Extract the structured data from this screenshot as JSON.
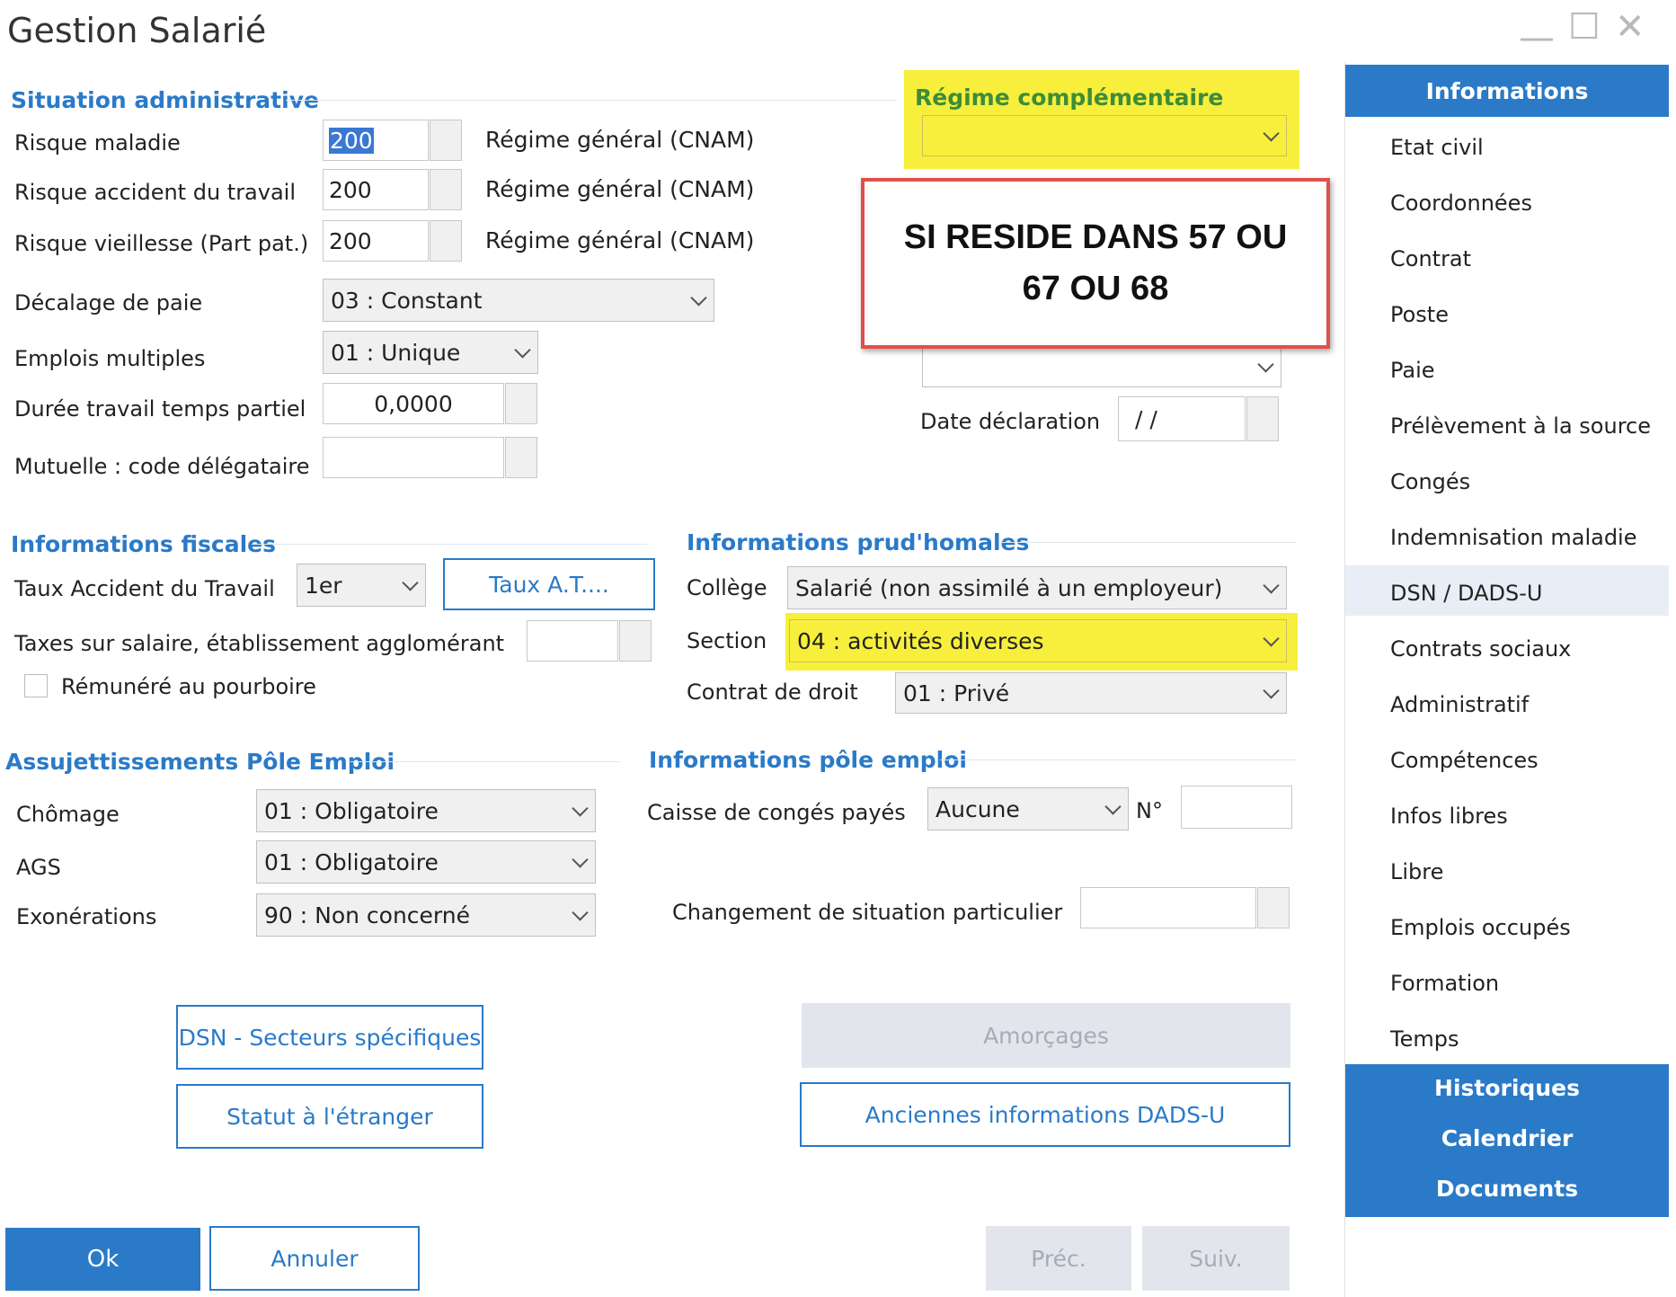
{
  "window": {
    "title": "Gestion Salarié",
    "minimize": "—",
    "maximize": "☐",
    "close": "✕"
  },
  "situation_admin": {
    "title": "Situation administrative",
    "risque_maladie": {
      "label": "Risque maladie",
      "value": "200",
      "regime": "Régime général (CNAM)"
    },
    "risque_accident": {
      "label": "Risque accident du travail",
      "value": "200",
      "regime": "Régime général (CNAM)"
    },
    "risque_vieillesse": {
      "label": "Risque vieillesse (Part pat.)",
      "value": "200",
      "regime": "Régime général (CNAM)"
    },
    "decalage_paie": {
      "label": "Décalage de paie",
      "value": "03 : Constant"
    },
    "emplois_multiples": {
      "label": "Emplois multiples",
      "value": "01 : Unique"
    },
    "duree_travail": {
      "label": "Durée travail temps partiel",
      "value": "0,0000"
    },
    "mutuelle": {
      "label": "Mutuelle : code délégataire",
      "value": ""
    }
  },
  "regime_complementaire": {
    "title": "Régime complémentaire",
    "value": ""
  },
  "annotation": {
    "line1": "SI RESIDE DANS 57 OU",
    "line2": "67 OU 68"
  },
  "date_declaration": {
    "label": "Date déclaration",
    "value": "/ /"
  },
  "infos_fiscales": {
    "title": "Informations fiscales",
    "taux_accident": {
      "label": "Taux Accident du Travail",
      "value": "1er"
    },
    "taux_button": "Taux A.T....",
    "taxes": {
      "label": "Taxes sur salaire, établissement agglomérant",
      "value": ""
    },
    "pourboire": {
      "label": "Rémunéré au pourboire",
      "checked": false
    }
  },
  "prudhomales": {
    "title": "Informations prud'homales",
    "college": {
      "label": "Collège",
      "value": "Salarié (non assimilé à un employeur)"
    },
    "section": {
      "label": "Section",
      "value": "04 : activités diverses"
    },
    "contrat_droit": {
      "label": "Contrat de droit",
      "value": "01 : Privé"
    }
  },
  "pole_emploi": {
    "title": "Assujettissements Pôle Emploi",
    "chomage": {
      "label": "Chômage",
      "value": "01 : Obligatoire"
    },
    "ags": {
      "label": "AGS",
      "value": "01 : Obligatoire"
    },
    "exonerations": {
      "label": "Exonérations",
      "value": "90 : Non concerné"
    }
  },
  "infos_pole_emploi": {
    "title": "Informations pôle emploi",
    "caisse": {
      "label": "Caisse de congés payés",
      "value": "Aucune",
      "num_label": "N°",
      "num_value": ""
    },
    "changement": {
      "label": "Changement de situation particulier",
      "value": ""
    }
  },
  "buttons": {
    "dsn_secteurs": "DSN - Secteurs spécifiques",
    "statut_etranger": "Statut à l'étranger",
    "amorcages": "Amorçages",
    "anciennes_dads": "Anciennes informations DADS-U",
    "ok": "Ok",
    "annuler": "Annuler",
    "prec": "Préc.",
    "suiv": "Suiv."
  },
  "sidebar": {
    "header": "Informations",
    "items": [
      "Etat civil",
      "Coordonnées",
      "Contrat",
      "Poste",
      "Paie",
      "Prélèvement à la source",
      "Congés",
      "Indemnisation maladie",
      "DSN / DADS-U",
      "Contrats sociaux",
      "Administratif",
      "Compétences",
      "Infos libres",
      "Libre",
      "Emplois occupés",
      "Formation",
      "Temps"
    ],
    "active_index": 8,
    "bottom": [
      "Historiques",
      "Calendrier",
      "Documents"
    ]
  },
  "colors": {
    "accent": "#2a7ac8",
    "highlight": "#f7ef3c",
    "annotation_border": "#e0504a"
  }
}
